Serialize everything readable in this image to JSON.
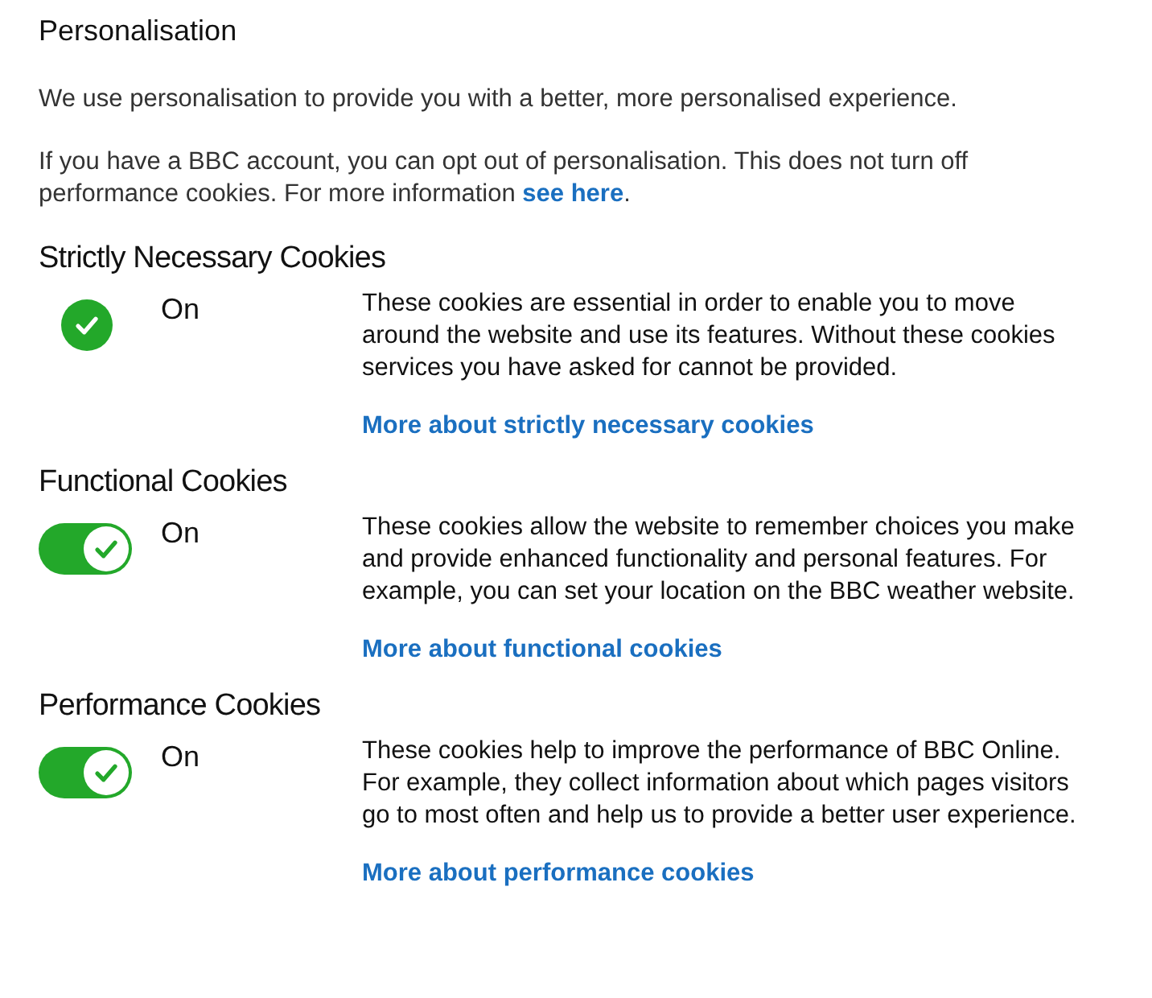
{
  "title": "Personalisation",
  "intro": "We use personalisation to provide you with a better, more personalised experience.",
  "account_note": {
    "text_before": "If you have a BBC account, you can opt out of personalisation. This does not turn off performance cookies. For more information ",
    "link": "see here",
    "text_after": "."
  },
  "sections": [
    {
      "heading": "Strictly Necessary Cookies",
      "kind": "locked",
      "on": true,
      "status": "On",
      "description": "These cookies are essential in order to enable you to move around the website and use its features. Without these cookies services you have asked for cannot be provided.",
      "link": "More about strictly necessary cookies"
    },
    {
      "heading": "Functional Cookies",
      "kind": "toggle",
      "on": true,
      "status": "On",
      "description": "These cookies allow the website to remember choices you make and provide enhanced functionality and personal features. For example, you can set your location on the BBC weather website.",
      "link": "More about functional cookies"
    },
    {
      "heading": "Performance Cookies",
      "kind": "toggle",
      "on": true,
      "status": "On",
      "description": "These cookies help to improve the performance of BBC Online. For example, they collect information about which pages visitors go to most often and help us to provide a better user experience.",
      "link": "More about performance cookies"
    }
  ]
}
